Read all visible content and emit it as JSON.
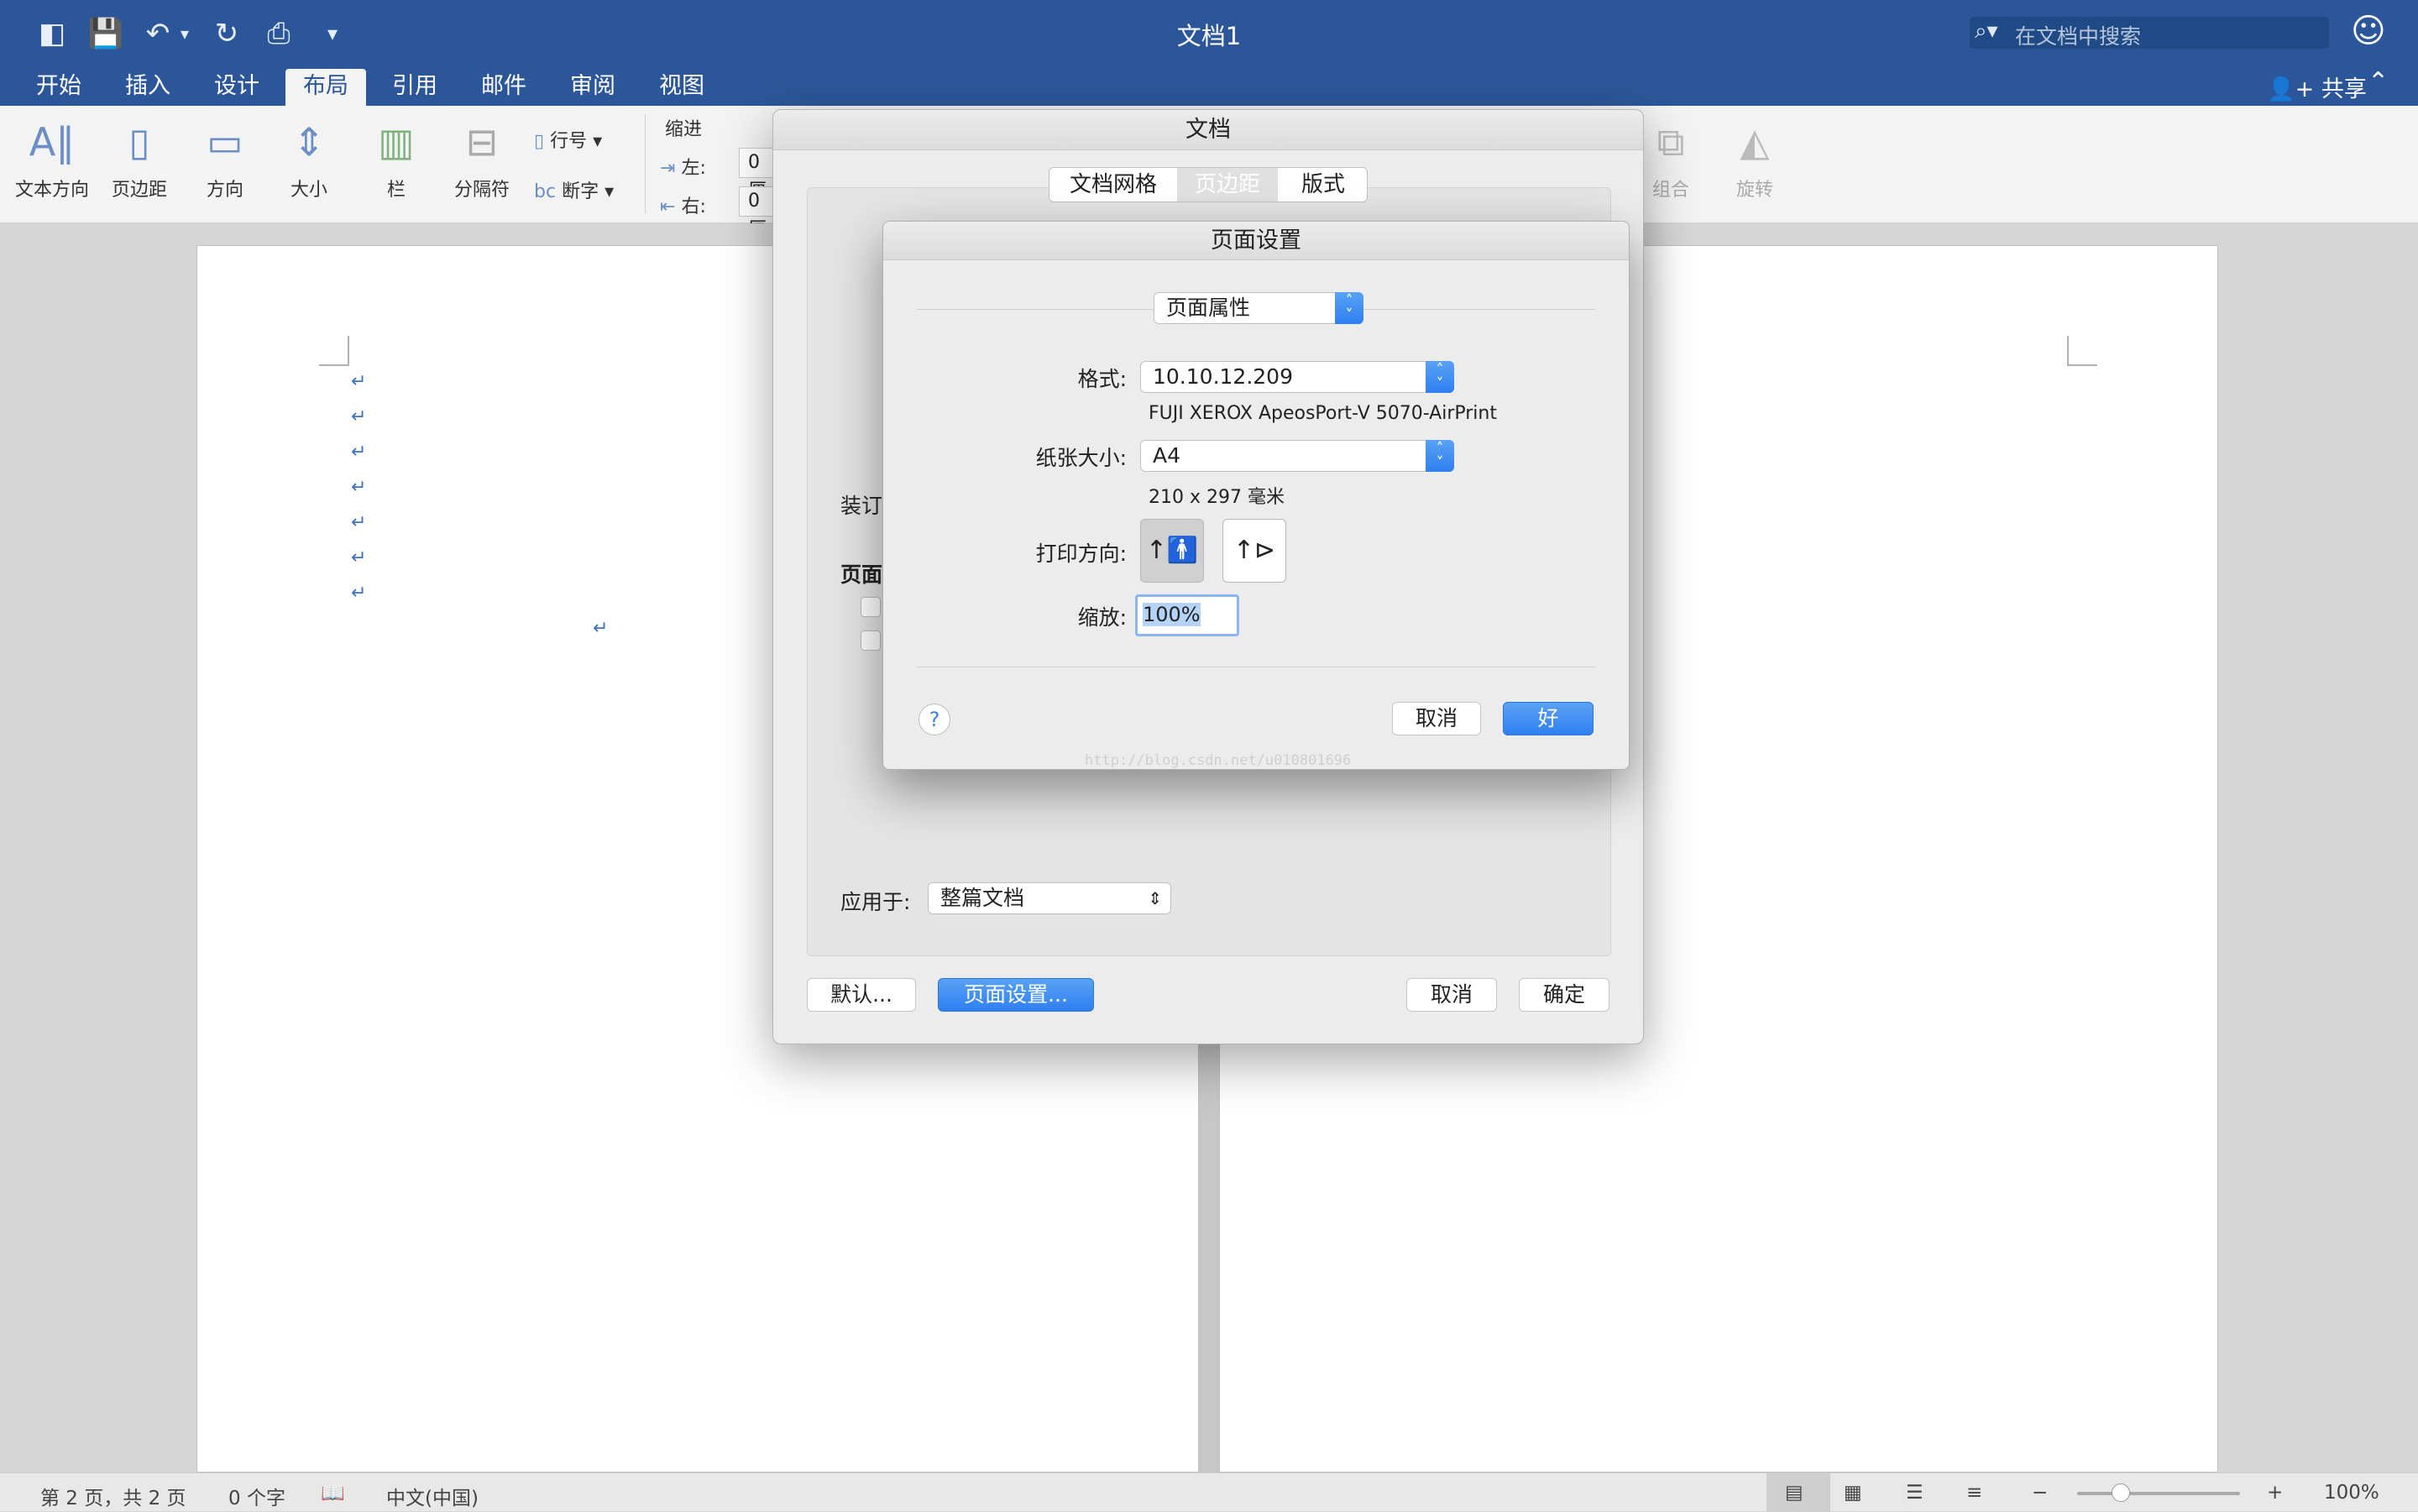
{
  "window": {
    "title": "文档1",
    "search_placeholder": "在文档中搜索"
  },
  "ribbon_tabs": [
    "开始",
    "插入",
    "设计",
    "布局",
    "引用",
    "邮件",
    "审阅",
    "视图"
  ],
  "active_tab": "布局",
  "share_label": "共享",
  "ribbon": {
    "text_direction": "文本方向",
    "margins": "页边距",
    "orientation": "方向",
    "size": "大小",
    "columns": "栏",
    "breaks": "分隔符",
    "line_numbers": "行号",
    "hyphenation": "断字",
    "indent_label": "缩进",
    "indent_left": "左:",
    "indent_right": "右:",
    "indent_value": "0 厘",
    "group": "组合",
    "rotate": "旋转"
  },
  "doc_dialog": {
    "title": "文档",
    "tabs": [
      "文档网格",
      "页边距",
      "版式"
    ],
    "selected_tab": "页边距",
    "gutter_label": "装订",
    "pages_label": "页面",
    "apply_label": "应用于:",
    "apply_value": "整篇文档",
    "default_button": "默认...",
    "page_setup_button": "页面设置...",
    "cancel_button": "取消",
    "ok_button": "确定"
  },
  "page_setup": {
    "title": "页面设置",
    "settings_popup": "页面属性",
    "format_label": "格式:",
    "format_value": "10.10.12.209",
    "printer_name": "FUJI XEROX ApeosPort-V 5070-AirPrint",
    "paper_label": "纸张大小:",
    "paper_value": "A4",
    "paper_dims": "210 x 297 毫米",
    "orientation_label": "打印方向:",
    "scale_label": "缩放:",
    "scale_value": "100%",
    "help": "?",
    "cancel_button": "取消",
    "ok_button": "好",
    "watermark": "http://blog.csdn.net/u010801696"
  },
  "document": {
    "paragraph_mark": "↵"
  },
  "statusbar": {
    "page_info": "第 2 页，共 2 页",
    "word_count": "0 个字",
    "language": "中文(中国)",
    "zoom": "100%"
  },
  "zoom_percent": 100,
  "colors": {
    "brand": "#2b579a",
    "accent": "#2f7ff0"
  }
}
